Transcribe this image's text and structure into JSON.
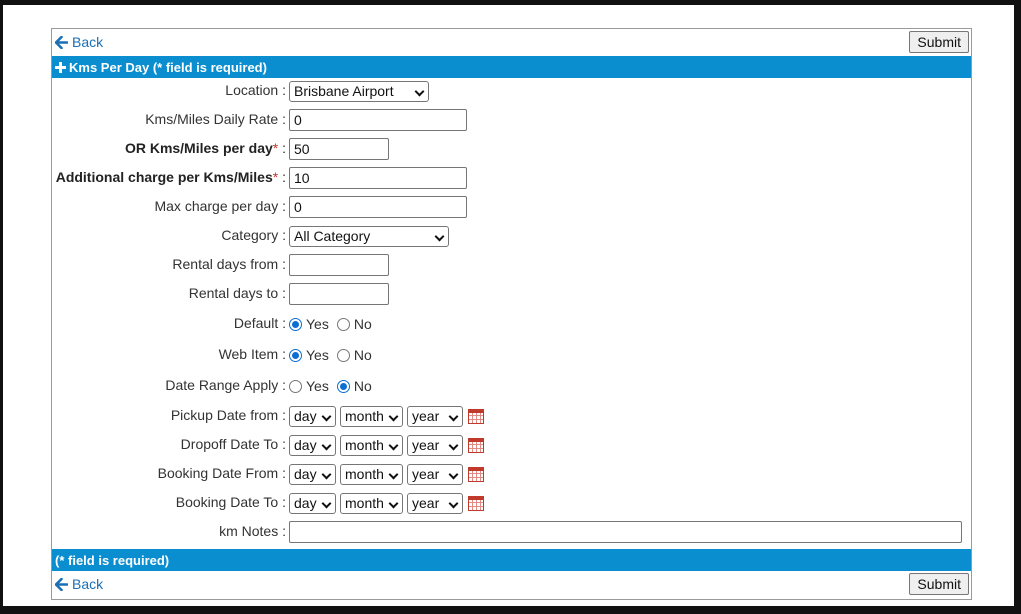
{
  "nav": {
    "back_label": "Back",
    "submit_label": "Submit"
  },
  "header_bar": {
    "title": "Kms Per Day (* field is required)"
  },
  "footer_bar": {
    "text": "(* field is required)"
  },
  "form": {
    "location": {
      "label": "Location :",
      "value": "Brisbane Airport"
    },
    "daily_rate": {
      "label": "Kms/Miles Daily Rate :",
      "value": "0"
    },
    "per_day": {
      "label": "OR Kms/Miles per day",
      "required_mark": "*",
      "colon": " :",
      "value": "50"
    },
    "additional_charge": {
      "label": "Additional charge per Kms/Miles",
      "required_mark": "*",
      "colon": " :",
      "value": "10"
    },
    "max_charge": {
      "label": "Max charge per day :",
      "value": "0"
    },
    "category": {
      "label": "Category :",
      "value": "All Category"
    },
    "rental_days_from": {
      "label": "Rental days from :",
      "value": ""
    },
    "rental_days_to": {
      "label": "Rental days to :",
      "value": ""
    },
    "default": {
      "label": "Default :",
      "yes": "Yes",
      "no": "No",
      "selected": "Yes"
    },
    "web_item": {
      "label": "Web Item :",
      "yes": "Yes",
      "no": "No",
      "selected": "Yes"
    },
    "date_range_apply": {
      "label": "Date Range Apply :",
      "yes": "Yes",
      "no": "No",
      "selected": "No"
    },
    "pickup_date_from": {
      "label": "Pickup Date from :",
      "day": "day",
      "month": "month",
      "year": "year"
    },
    "dropoff_date_to": {
      "label": "Dropoff Date To :",
      "day": "day",
      "month": "month",
      "year": "year"
    },
    "booking_date_from": {
      "label": "Booking Date From :",
      "day": "day",
      "month": "month",
      "year": "year"
    },
    "booking_date_to": {
      "label": "Booking Date To :",
      "day": "day",
      "month": "month",
      "year": "year"
    },
    "km_notes": {
      "label": "km Notes :",
      "value": ""
    }
  },
  "icons": {
    "back": "arrow-left-icon",
    "header": "plus-icon",
    "calendar": "calendar-icon"
  },
  "colors": {
    "accent_bar": "#0b8ecf",
    "link": "#1a6fb5",
    "required": "#c0392b",
    "radio_on": "#0b6ed0"
  }
}
